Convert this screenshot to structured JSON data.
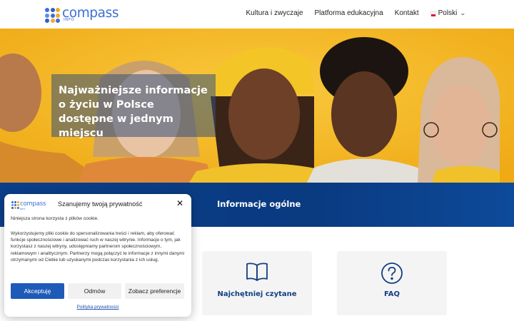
{
  "header": {
    "logo": {
      "word": "compass",
      "sub": "INFO"
    },
    "nav": [
      {
        "label": "Kultura i zwyczaje"
      },
      {
        "label": "Platforma edukacyjna"
      },
      {
        "label": "Kontakt"
      }
    ],
    "language": {
      "label": "Polski",
      "flag_icon": "poland-flag-icon",
      "chevron_icon": "chevron-down-icon"
    }
  },
  "hero": {
    "title": "Najważniejsze informacje o życiu w Polsce dostępne w jednym miejscu"
  },
  "section": {
    "title": "Informacje ogólne"
  },
  "cards": [
    {
      "label": "Najchętniej czytane",
      "icon": "open-book-icon"
    },
    {
      "label": "FAQ",
      "icon": "question-circle-icon"
    }
  ],
  "cookie_banner": {
    "logo_word": "compass",
    "logo_sub": "INFO",
    "title": "Szanujemy twoją prywatność",
    "close_icon": "close-icon",
    "intro": "Niniejsza strona korzysta z plików cookie.",
    "body": "Wykorzystujemy pliki cookie do spersonalizowania treści i reklam, aby oferować funkcje społecznościowe i analizować ruch w naszej witrynie. Informacje o tym, jak korzystasz z naszej witryny, udostępniamy partnerom społecznościowym, reklamowym i analitycznym. Partnerzy mogą połączyć te informacje z innymi danymi otrzymanymi od Ciebie lub uzyskanymi podczas korzystania z ich usług.",
    "accept_label": "Akceptuję",
    "reject_label": "Odmów",
    "preferences_label": "Zobacz preferencje",
    "policy_link": "Polityka prywatności"
  },
  "colors": {
    "brand_blue": "#3a6fd8",
    "band_blue": "#0b3f8a",
    "accept_blue": "#1e5bb8",
    "hero_yellow": "#f4b623",
    "logo_dots": [
      "#3a6fd8",
      "#2f5ec4",
      "#f0a92e",
      "#5f8ee8",
      "#3a6fd8",
      "#f0a92e",
      "#2f5ec4",
      "#f0a92e",
      "#3a6fd8"
    ]
  }
}
